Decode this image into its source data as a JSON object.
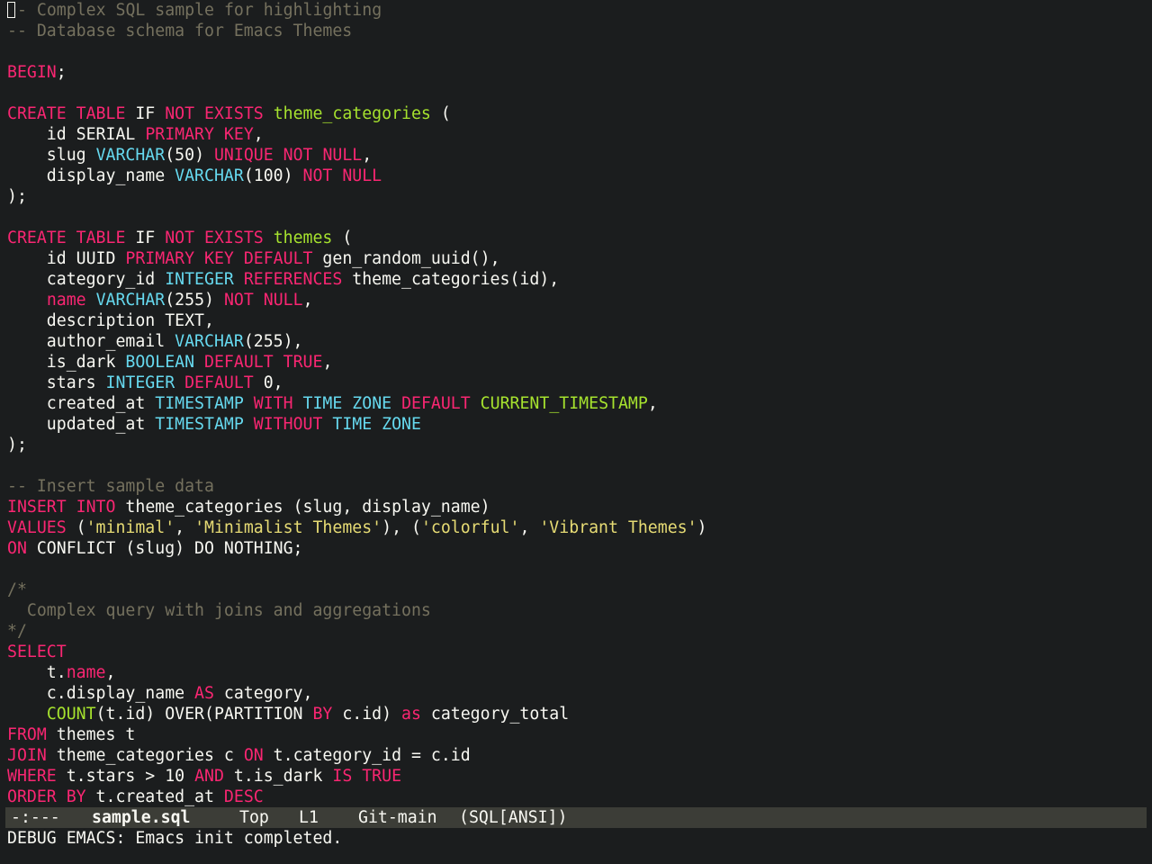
{
  "colors": {
    "background": "#1b1d1e",
    "keyword": "#f92672",
    "type": "#66d9ef",
    "function_or_name": "#a6e22e",
    "string": "#e6db74",
    "comment": "#75715e",
    "text": "#f8f8f2",
    "modeline_bg": "#3c3d37"
  },
  "editor": {
    "lines": [
      [
        [
          "cm",
          "- Complex SQL sample for highlighting"
        ]
      ],
      [
        [
          "cm",
          "-- Database schema for Emacs Themes"
        ]
      ],
      [],
      [
        [
          "kw",
          "BEGIN"
        ],
        [
          "txt",
          ";"
        ]
      ],
      [],
      [
        [
          "kw",
          "CREATE"
        ],
        [
          "txt",
          " "
        ],
        [
          "kw",
          "TABLE"
        ],
        [
          "txt",
          " IF "
        ],
        [
          "kw",
          "NOT"
        ],
        [
          "txt",
          " "
        ],
        [
          "kw",
          "EXISTS"
        ],
        [
          "txt",
          " "
        ],
        [
          "fn",
          "theme_categories"
        ],
        [
          "txt",
          " ("
        ]
      ],
      [
        [
          "txt",
          "    id SERIAL "
        ],
        [
          "kw",
          "PRIMARY"
        ],
        [
          "txt",
          " "
        ],
        [
          "kw",
          "KEY"
        ],
        [
          "txt",
          ","
        ]
      ],
      [
        [
          "txt",
          "    slug "
        ],
        [
          "ty",
          "VARCHAR"
        ],
        [
          "txt",
          "(50) "
        ],
        [
          "kw",
          "UNIQUE"
        ],
        [
          "txt",
          " "
        ],
        [
          "kw",
          "NOT"
        ],
        [
          "txt",
          " "
        ],
        [
          "kw",
          "NULL"
        ],
        [
          "txt",
          ","
        ]
      ],
      [
        [
          "txt",
          "    display_name "
        ],
        [
          "ty",
          "VARCHAR"
        ],
        [
          "txt",
          "(100) "
        ],
        [
          "kw",
          "NOT"
        ],
        [
          "txt",
          " "
        ],
        [
          "kw",
          "NULL"
        ]
      ],
      [
        [
          "txt",
          ");"
        ]
      ],
      [],
      [
        [
          "kw",
          "CREATE"
        ],
        [
          "txt",
          " "
        ],
        [
          "kw",
          "TABLE"
        ],
        [
          "txt",
          " IF "
        ],
        [
          "kw",
          "NOT"
        ],
        [
          "txt",
          " "
        ],
        [
          "kw",
          "EXISTS"
        ],
        [
          "txt",
          " "
        ],
        [
          "fn",
          "themes"
        ],
        [
          "txt",
          " ("
        ]
      ],
      [
        [
          "txt",
          "    id UUID "
        ],
        [
          "kw",
          "PRIMARY"
        ],
        [
          "txt",
          " "
        ],
        [
          "kw",
          "KEY"
        ],
        [
          "txt",
          " "
        ],
        [
          "kw",
          "DEFAULT"
        ],
        [
          "txt",
          " gen_random_uuid(),"
        ]
      ],
      [
        [
          "txt",
          "    category_id "
        ],
        [
          "ty",
          "INTEGER"
        ],
        [
          "txt",
          " "
        ],
        [
          "kw",
          "REFERENCES"
        ],
        [
          "txt",
          " theme_categories(id),"
        ]
      ],
      [
        [
          "txt",
          "    "
        ],
        [
          "kw",
          "name"
        ],
        [
          "txt",
          " "
        ],
        [
          "ty",
          "VARCHAR"
        ],
        [
          "txt",
          "(255) "
        ],
        [
          "kw",
          "NOT"
        ],
        [
          "txt",
          " "
        ],
        [
          "kw",
          "NULL"
        ],
        [
          "txt",
          ","
        ]
      ],
      [
        [
          "txt",
          "    description TEXT,"
        ]
      ],
      [
        [
          "txt",
          "    author_email "
        ],
        [
          "ty",
          "VARCHAR"
        ],
        [
          "txt",
          "(255),"
        ]
      ],
      [
        [
          "txt",
          "    is_dark "
        ],
        [
          "ty",
          "BOOLEAN"
        ],
        [
          "txt",
          " "
        ],
        [
          "kw",
          "DEFAULT"
        ],
        [
          "txt",
          " "
        ],
        [
          "kw",
          "TRUE"
        ],
        [
          "txt",
          ","
        ]
      ],
      [
        [
          "txt",
          "    stars "
        ],
        [
          "ty",
          "INTEGER"
        ],
        [
          "txt",
          " "
        ],
        [
          "kw",
          "DEFAULT"
        ],
        [
          "txt",
          " 0,"
        ]
      ],
      [
        [
          "txt",
          "    created_at "
        ],
        [
          "ty",
          "TIMESTAMP"
        ],
        [
          "txt",
          " "
        ],
        [
          "kw",
          "WITH"
        ],
        [
          "txt",
          " "
        ],
        [
          "ty",
          "TIME"
        ],
        [
          "txt",
          " "
        ],
        [
          "ty",
          "ZONE"
        ],
        [
          "txt",
          " "
        ],
        [
          "kw",
          "DEFAULT"
        ],
        [
          "txt",
          " "
        ],
        [
          "fn",
          "CURRENT_TIMESTAMP"
        ],
        [
          "txt",
          ","
        ]
      ],
      [
        [
          "txt",
          "    updated_at "
        ],
        [
          "ty",
          "TIMESTAMP"
        ],
        [
          "txt",
          " "
        ],
        [
          "kw",
          "WITHOUT"
        ],
        [
          "txt",
          " "
        ],
        [
          "ty",
          "TIME"
        ],
        [
          "txt",
          " "
        ],
        [
          "ty",
          "ZONE"
        ]
      ],
      [
        [
          "txt",
          ");"
        ]
      ],
      [],
      [
        [
          "cm",
          "-- Insert sample data"
        ]
      ],
      [
        [
          "kw",
          "INSERT"
        ],
        [
          "txt",
          " "
        ],
        [
          "kw",
          "INTO"
        ],
        [
          "txt",
          " theme_categories (slug, display_name)"
        ]
      ],
      [
        [
          "kw",
          "VALUES"
        ],
        [
          "txt",
          " ("
        ],
        [
          "str",
          "'minimal'"
        ],
        [
          "txt",
          ", "
        ],
        [
          "str",
          "'Minimalist Themes'"
        ],
        [
          "txt",
          "), ("
        ],
        [
          "str",
          "'colorful'"
        ],
        [
          "txt",
          ", "
        ],
        [
          "str",
          "'Vibrant Themes'"
        ],
        [
          "txt",
          ")"
        ]
      ],
      [
        [
          "kw",
          "ON"
        ],
        [
          "txt",
          " CONFLICT (slug) DO NOTHING;"
        ]
      ],
      [],
      [
        [
          "cm",
          "/*"
        ]
      ],
      [
        [
          "cm",
          "  Complex query with joins and aggregations"
        ]
      ],
      [
        [
          "cm",
          "*/"
        ]
      ],
      [
        [
          "kw",
          "SELECT"
        ]
      ],
      [
        [
          "txt",
          "    t."
        ],
        [
          "kw",
          "name"
        ],
        [
          "txt",
          ","
        ]
      ],
      [
        [
          "txt",
          "    c.display_name "
        ],
        [
          "kw",
          "AS"
        ],
        [
          "txt",
          " category,"
        ]
      ],
      [
        [
          "txt",
          "    "
        ],
        [
          "fn",
          "COUNT"
        ],
        [
          "txt",
          "(t.id) OVER(PARTITION "
        ],
        [
          "kw",
          "BY"
        ],
        [
          "txt",
          " c.id) "
        ],
        [
          "kw",
          "as"
        ],
        [
          "txt",
          " category_total"
        ]
      ],
      [
        [
          "kw",
          "FROM"
        ],
        [
          "txt",
          " themes t"
        ]
      ],
      [
        [
          "kw",
          "JOIN"
        ],
        [
          "txt",
          " theme_categories c "
        ],
        [
          "kw",
          "ON"
        ],
        [
          "txt",
          " t.category_id = c.id"
        ]
      ],
      [
        [
          "kw",
          "WHERE"
        ],
        [
          "txt",
          " t.stars > 10 "
        ],
        [
          "kw",
          "AND"
        ],
        [
          "txt",
          " t.is_dark "
        ],
        [
          "kw",
          "IS"
        ],
        [
          "txt",
          " "
        ],
        [
          "kw",
          "TRUE"
        ]
      ],
      [
        [
          "kw",
          "ORDER"
        ],
        [
          "txt",
          " "
        ],
        [
          "kw",
          "BY"
        ],
        [
          "txt",
          " t.created_at "
        ],
        [
          "kw",
          "DESC"
        ]
      ]
    ]
  },
  "modeline": {
    "status": "-:---",
    "buffer": "sample.sql",
    "position": "Top",
    "line": "L1",
    "vc": "Git-main",
    "mode": "(SQL[ANSI])"
  },
  "echo_area": {
    "message": "DEBUG EMACS: Emacs init completed."
  }
}
